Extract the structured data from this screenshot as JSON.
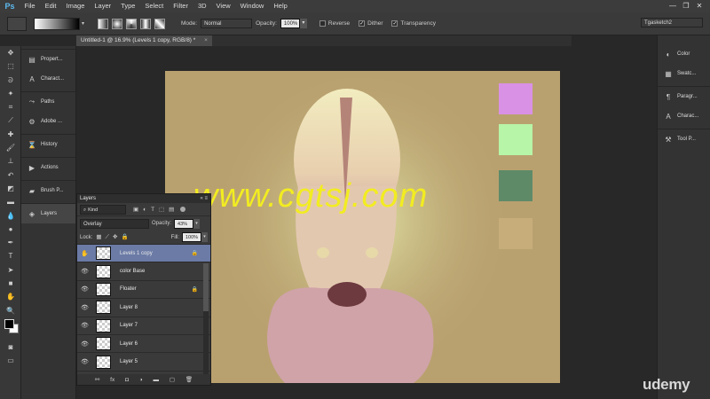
{
  "app": {
    "logo": "Ps",
    "menu": [
      "File",
      "Edit",
      "Image",
      "Layer",
      "Type",
      "Select",
      "Filter",
      "3D",
      "View",
      "Window",
      "Help"
    ],
    "window_controls": [
      "minimize-icon",
      "restore-icon",
      "close-icon"
    ]
  },
  "options": {
    "mode_label": "Mode:",
    "mode_value": "Normal",
    "opacity_label": "Opacity:",
    "opacity_value": "100%",
    "reverse_label": "Reverse",
    "dither_label": "Dither",
    "transparency_label": "Transparency",
    "workspace_value": "Tgasketch2"
  },
  "document": {
    "tab_title": "Untitled-1 @ 16.9% (Levels 1 copy, RGB/8) *",
    "tab_close": "×"
  },
  "left_panels": [
    {
      "icon": "info-icon",
      "label": "Propert..."
    },
    {
      "icon": "character-icon",
      "label": "Charact..."
    },
    {
      "icon": "paths-icon",
      "label": "Paths"
    },
    {
      "icon": "adobe-icon",
      "label": "Adobe ..."
    },
    {
      "icon": "history-icon",
      "label": "History"
    },
    {
      "icon": "actions-icon",
      "label": "Actions"
    },
    {
      "icon": "brush-icon",
      "label": "Brush P..."
    },
    {
      "icon": "layers-icon",
      "label": "Layers"
    }
  ],
  "right_panels": [
    {
      "icon": "color-icon",
      "label": "Color"
    },
    {
      "icon": "swatches-icon",
      "label": "Swatc..."
    },
    {
      "icon": "paragraph-icon",
      "label": "Paragr..."
    },
    {
      "icon": "character-icon",
      "label": "Charac..."
    },
    {
      "icon": "tool-preset-icon",
      "label": "Tool P..."
    }
  ],
  "swatch_colors": [
    "#d991e6",
    "#b7f5a8",
    "#5e8a68",
    "#c6ad7a"
  ],
  "canvas_color": "#b9a16f",
  "layers_panel": {
    "title": "Layers",
    "filter_label": "Kind",
    "blend_mode": "Overlay",
    "opacity_label": "Opacity:",
    "opacity_value": "43%",
    "lock_label": "Lock:",
    "fill_label": "Fill:",
    "fill_value": "100%",
    "layers": [
      {
        "name": "Levels 1 copy",
        "selected": true,
        "locked": true
      },
      {
        "name": "color Base",
        "selected": false,
        "locked": false
      },
      {
        "name": "Floater",
        "selected": false,
        "locked": true
      },
      {
        "name": "Layer 8",
        "selected": false,
        "locked": false
      },
      {
        "name": "Layer 7",
        "selected": false,
        "locked": false
      },
      {
        "name": "Layer 6",
        "selected": false,
        "locked": false
      },
      {
        "name": "Layer 5",
        "selected": false,
        "locked": false
      }
    ],
    "footer_icons": [
      "link-icon",
      "fx-icon",
      "mask-icon",
      "adjustment-icon",
      "folder-icon",
      "new-layer-icon",
      "trash-icon"
    ]
  },
  "watermark": "www.cgtsj.com",
  "brand": "udemy"
}
